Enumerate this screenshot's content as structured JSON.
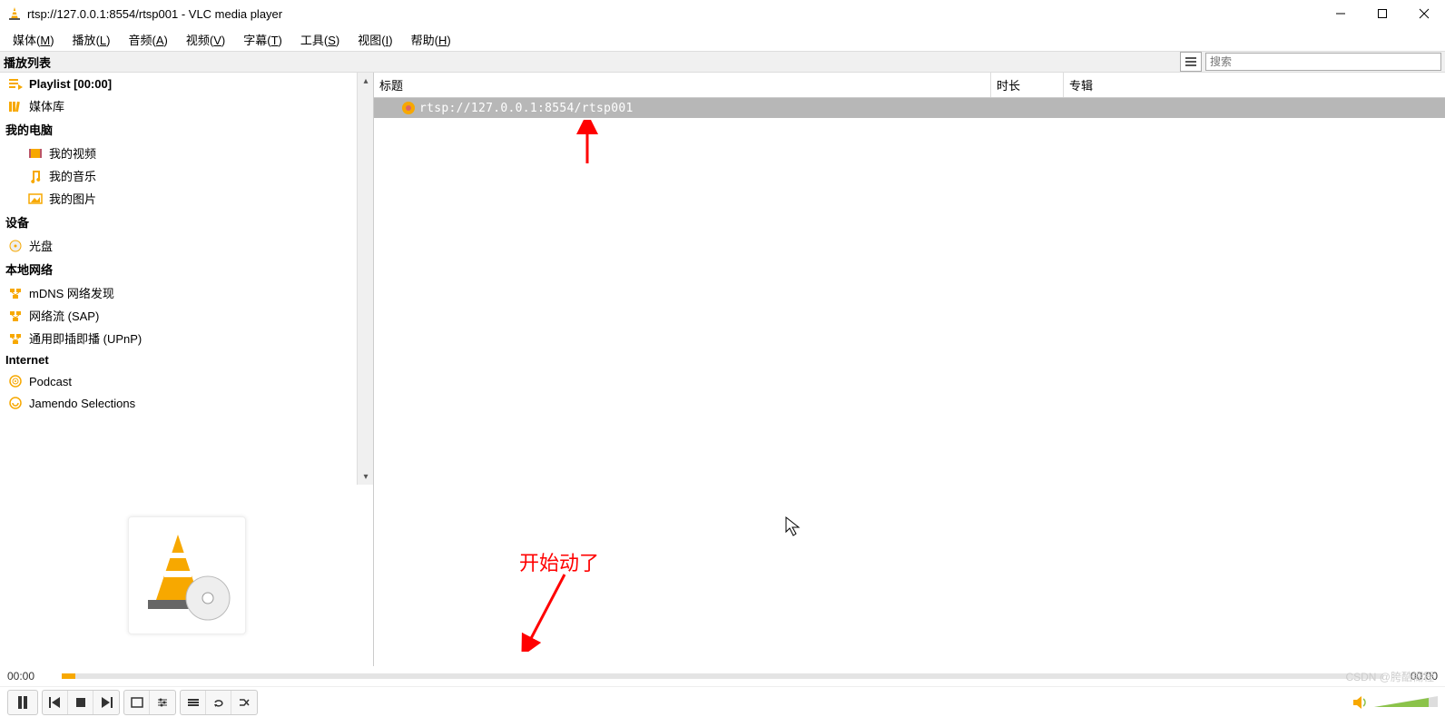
{
  "window": {
    "title": "rtsp://127.0.0.1:8554/rtsp001 - VLC media player"
  },
  "menu": {
    "media": {
      "label": "媒体",
      "key": "M"
    },
    "playback": {
      "label": "播放",
      "key": "L"
    },
    "audio": {
      "label": "音频",
      "key": "A"
    },
    "video": {
      "label": "视频",
      "key": "V"
    },
    "subtitle": {
      "label": "字幕",
      "key": "T"
    },
    "tools": {
      "label": "工具",
      "key": "S"
    },
    "view": {
      "label": "视图",
      "key": "I"
    },
    "help": {
      "label": "帮助",
      "key": "H"
    }
  },
  "playlist_header": {
    "label": "播放列表",
    "search_placeholder": "搜索"
  },
  "sidebar": {
    "items": [
      {
        "kind": "item",
        "icon": "playlist",
        "label": "Playlist [00:00]",
        "selected": true
      },
      {
        "kind": "item",
        "icon": "library",
        "label": "媒体库"
      },
      {
        "kind": "group",
        "label": "我的电脑"
      },
      {
        "kind": "item",
        "icon": "video",
        "label": "我的视频",
        "indent": true
      },
      {
        "kind": "item",
        "icon": "music",
        "label": "我的音乐",
        "indent": true
      },
      {
        "kind": "item",
        "icon": "picture",
        "label": "我的图片",
        "indent": true
      },
      {
        "kind": "group",
        "label": "设备"
      },
      {
        "kind": "item",
        "icon": "disc",
        "label": "光盘"
      },
      {
        "kind": "group",
        "label": "本地网络"
      },
      {
        "kind": "item",
        "icon": "net",
        "label": "mDNS 网络发现"
      },
      {
        "kind": "item",
        "icon": "net",
        "label": "网络流 (SAP)"
      },
      {
        "kind": "item",
        "icon": "net",
        "label": "通用即插即播  (UPnP)"
      },
      {
        "kind": "group",
        "label": "Internet"
      },
      {
        "kind": "item",
        "icon": "podcast",
        "label": "Podcast"
      },
      {
        "kind": "item",
        "icon": "jamendo",
        "label": "Jamendo Selections"
      }
    ]
  },
  "columns": {
    "title": "标题",
    "duration": "时长",
    "album": "专辑"
  },
  "rows": [
    {
      "title": "rtsp://127.0.0.1:8554/rtsp001"
    }
  ],
  "annotation": {
    "text": "开始动了"
  },
  "time": {
    "current": "00:00",
    "total": "00:00"
  },
  "watermark": "CSDN @胯酷糊程"
}
